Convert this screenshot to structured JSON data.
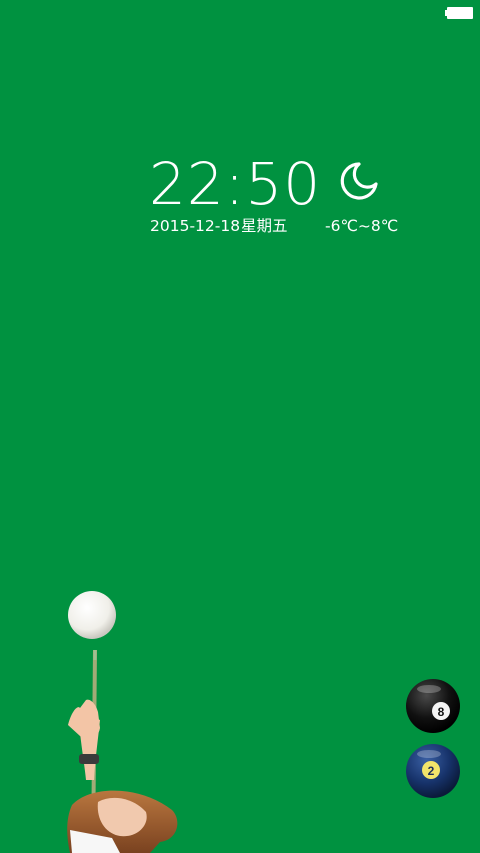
{
  "status_bar": {
    "battery_icon": "battery-full-icon"
  },
  "lockscreen": {
    "time": "22:50",
    "date": "2015-12-18",
    "weekday": "星期五",
    "weather": {
      "icon": "moon-night-icon",
      "temperature": "-6℃~8℃"
    }
  },
  "shortcuts": [
    {
      "icon": "eight-ball-icon",
      "label": "8"
    },
    {
      "icon": "two-ball-icon",
      "label": "2"
    }
  ],
  "illustration": {
    "description_icon": "billiards-girl-cue-ball-illustration"
  },
  "colors": {
    "background": "#009240",
    "text": "#ffffff"
  }
}
